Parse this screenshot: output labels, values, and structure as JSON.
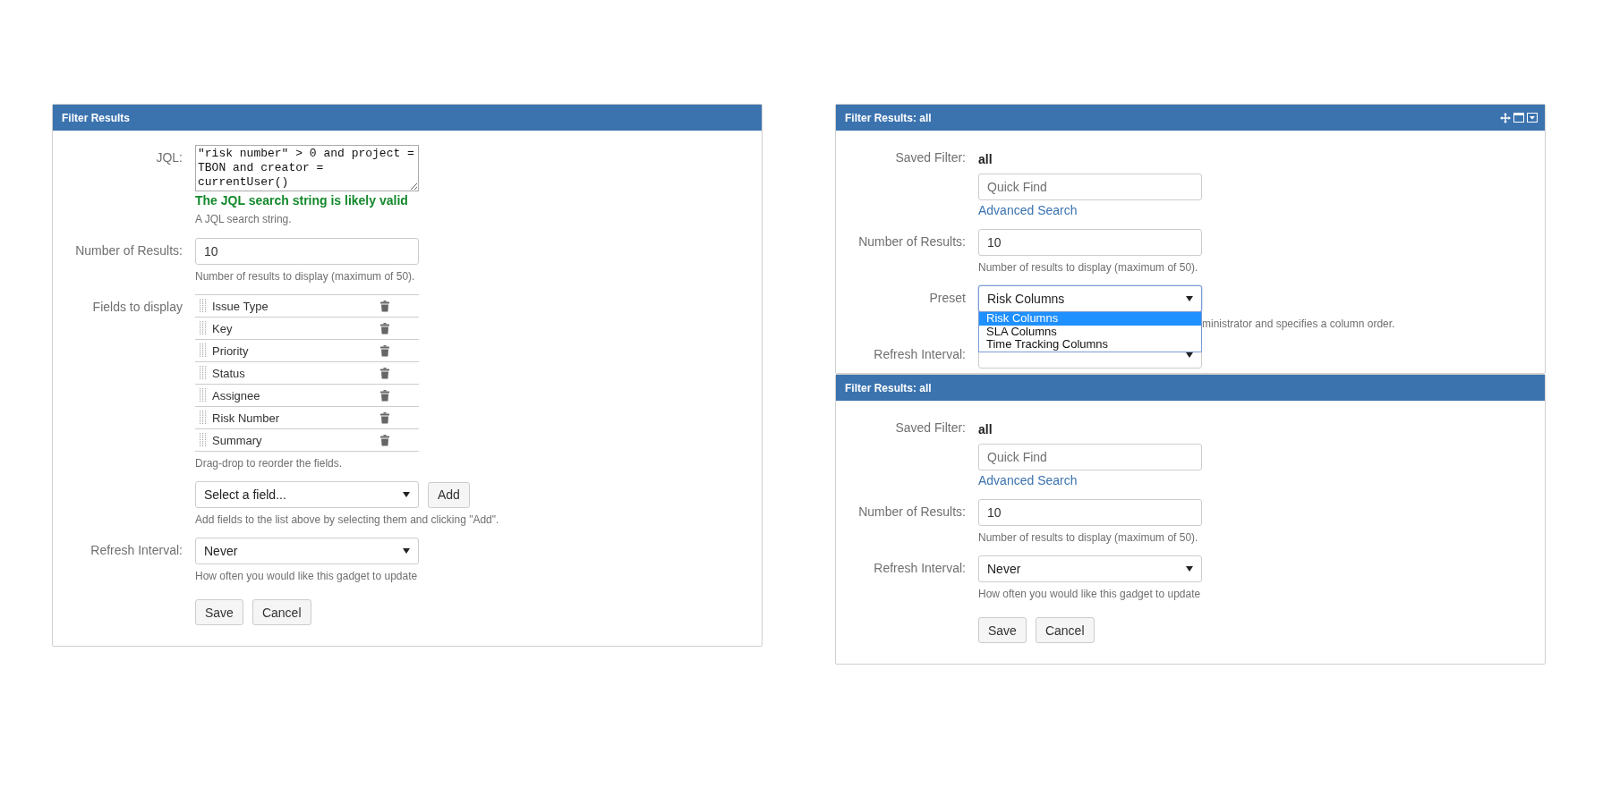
{
  "columns": [
    [
      {
        "title": "Filter Results",
        "toolbar_icons": false,
        "rows": [
          {
            "kind": "jql",
            "label": "JQL:",
            "value": "\"risk number\" > 0 and project = TBON and creator = currentUser()",
            "status": "The JQL search string is likely valid",
            "description": "A JQL search string."
          },
          {
            "kind": "text",
            "label": "Number of Results:",
            "value": "10",
            "description": "Number of results to display (maximum of 50)."
          },
          {
            "kind": "field_list",
            "label": "Fields to display",
            "items": [
              "Issue Type",
              "Key",
              "Priority",
              "Status",
              "Assignee",
              "Risk Number",
              "Summary"
            ],
            "description": "Drag-drop to reorder the fields."
          },
          {
            "kind": "picker",
            "value": "Select a field...",
            "button": "Add",
            "description": "Add fields to the list above by selecting them and clicking \"Add\"."
          },
          {
            "kind": "select",
            "label": "Refresh Interval:",
            "value": "Never",
            "description": "How often you would like this gadget to update"
          }
        ],
        "buttons": [
          "Save",
          "Cancel"
        ]
      }
    ],
    [
      {
        "title": "Filter Results: all",
        "toolbar_icons": true,
        "rows": [
          {
            "kind": "saved_filter",
            "label": "Saved Filter:",
            "value": "all",
            "placeholder": "Quick Find",
            "link": "Advanced Search"
          },
          {
            "kind": "text",
            "label": "Number of Results:",
            "value": "10",
            "description": "Number of results to display (maximum of 50)."
          },
          {
            "kind": "select",
            "label": "Preset",
            "value": "Risk Columns",
            "focused": true,
            "options": [
              {
                "label": "Risk Columns",
                "selected": true
              },
              {
                "label": "SLA Columns",
                "selected": false
              },
              {
                "label": "Time Tracking Columns",
                "selected": false
              }
            ],
            "description": "ministrator and specifies a column order."
          },
          {
            "kind": "select",
            "label": "Refresh Interval:"
          }
        ]
      },
      {
        "title": "Filter Results: all",
        "toolbar_icons": false,
        "rows": [
          {
            "kind": "saved_filter",
            "label": "Saved Filter:",
            "value": "all",
            "placeholder": "Quick Find",
            "link": "Advanced Search"
          },
          {
            "kind": "text",
            "label": "Number of Results:",
            "value": "10",
            "description": "Number of results to display (maximum of 50)."
          },
          {
            "kind": "select",
            "label": "Refresh Interval:",
            "value": "Never",
            "description": "How often you would like this gadget to update"
          }
        ],
        "buttons": [
          "Save",
          "Cancel"
        ]
      }
    ]
  ]
}
